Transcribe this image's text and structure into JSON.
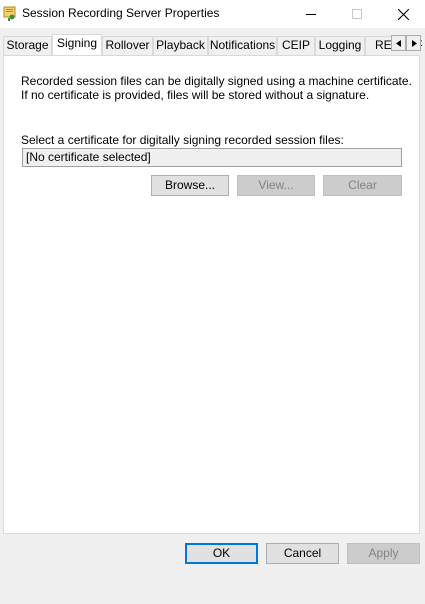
{
  "window": {
    "title": "Session Recording Server Properties"
  },
  "tabs": [
    {
      "label": "Storage"
    },
    {
      "label": "Signing"
    },
    {
      "label": "Rollover"
    },
    {
      "label": "Playback"
    },
    {
      "label": "Notifications"
    },
    {
      "label": "CEIP"
    },
    {
      "label": "Logging"
    },
    {
      "label": "REST API"
    }
  ],
  "signing": {
    "description_line1": "Recorded session files can be digitally signed using a machine certificate.",
    "description_line2": "If no certificate is provided, files will be stored without a signature.",
    "select_label": "Select a certificate for digitally signing recorded session files:",
    "certificate_value": "[No certificate selected]",
    "browse_label": "Browse...",
    "view_label": "View...",
    "clear_label": "Clear"
  },
  "footer": {
    "ok_label": "OK",
    "cancel_label": "Cancel",
    "apply_label": "Apply"
  },
  "colors": {
    "accent": "#0078d7",
    "disabled_text": "#838383"
  },
  "icons": {
    "app": "certificate-key-icon",
    "tab_scroll_left": "triangle-left-icon",
    "tab_scroll_right": "triangle-right-icon"
  }
}
